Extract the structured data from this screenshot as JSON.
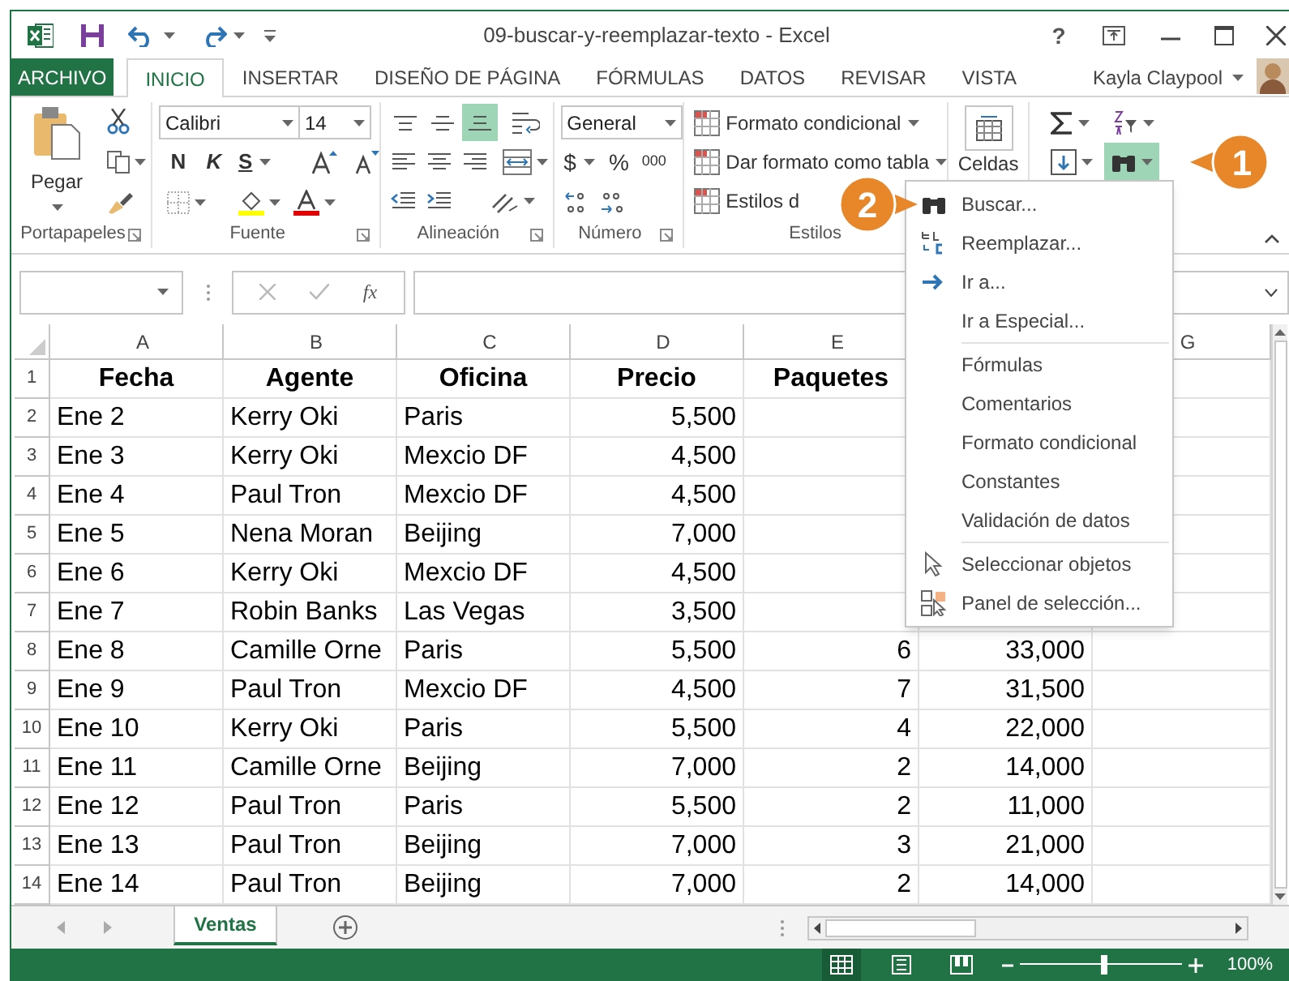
{
  "window": {
    "title": "09-buscar-y-reemplazar-texto - Excel",
    "help": "?"
  },
  "tabs": [
    {
      "label": "ARCHIVO",
      "kind": "file",
      "selected": false
    },
    {
      "label": "INICIO",
      "kind": "tab",
      "selected": true
    },
    {
      "label": "INSERTAR",
      "kind": "tab",
      "selected": false
    },
    {
      "label": "DISEÑO DE PÁGINA",
      "kind": "tab",
      "selected": false
    },
    {
      "label": "FÓRMULAS",
      "kind": "tab",
      "selected": false
    },
    {
      "label": "DATOS",
      "kind": "tab",
      "selected": false
    },
    {
      "label": "REVISAR",
      "kind": "tab",
      "selected": false
    },
    {
      "label": "VISTA",
      "kind": "tab",
      "selected": false
    }
  ],
  "user": {
    "name": "Kayla Claypool"
  },
  "ribbon": {
    "clipboard": {
      "paste": "Pegar",
      "label": "Portapapeles"
    },
    "font": {
      "name": "Calibri",
      "size": "14",
      "bold": "N",
      "italic": "K",
      "underline": "S",
      "label": "Fuente"
    },
    "alignment": {
      "label": "Alineación",
      "vertical": [
        {
          "selected": false
        },
        {
          "selected": false
        },
        {
          "selected": true
        }
      ]
    },
    "number": {
      "format": "General",
      "currency": "$",
      "percent": "%",
      "thousands": "000",
      "label": "Número"
    },
    "styles": {
      "items": [
        "Formato condicional",
        "Dar formato como tabla",
        "Estilos d"
      ],
      "label": "Estilos"
    },
    "cells": {
      "label": "Celdas"
    },
    "editing": {
      "find_expanded": true
    }
  },
  "formula_bar": {
    "function_label": "fx"
  },
  "sheet": {
    "columns": [
      "A",
      "B",
      "C",
      "D",
      "E",
      null,
      "G"
    ],
    "rows": [
      {
        "number": "1",
        "header": true,
        "cells": [
          "Fecha",
          "Agente",
          "Oficina",
          "Precio",
          "Paquetes"
        ]
      },
      {
        "number": "2",
        "header": false,
        "cells": [
          "Ene 2",
          "Kerry Oki",
          "Paris",
          "5,500"
        ]
      },
      {
        "number": "3",
        "header": false,
        "cells": [
          "Ene 3",
          "Kerry Oki",
          "Mexcio DF",
          "4,500"
        ]
      },
      {
        "number": "4",
        "header": false,
        "cells": [
          "Ene 4",
          "Paul Tron",
          "Mexcio DF",
          "4,500"
        ]
      },
      {
        "number": "5",
        "header": false,
        "cells": [
          "Ene 5",
          "Nena Moran",
          "Beijing",
          "7,000"
        ]
      },
      {
        "number": "6",
        "header": false,
        "cells": [
          "Ene 6",
          "Kerry Oki",
          "Mexcio DF",
          "4,500"
        ]
      },
      {
        "number": "7",
        "header": false,
        "cells": [
          "Ene 7",
          "Robin Banks",
          "Las Vegas",
          "3,500"
        ]
      },
      {
        "number": "8",
        "header": false,
        "cells": [
          "Ene 8",
          "Camille Orne",
          "Paris",
          "5,500",
          "6",
          "33,000"
        ]
      },
      {
        "number": "9",
        "header": false,
        "cells": [
          "Ene 9",
          "Paul Tron",
          "Mexcio DF",
          "4,500",
          "7",
          "31,500"
        ]
      },
      {
        "number": "10",
        "header": false,
        "cells": [
          "Ene 10",
          "Kerry Oki",
          "Paris",
          "5,500",
          "4",
          "22,000"
        ]
      },
      {
        "number": "11",
        "header": false,
        "cells": [
          "Ene 11",
          "Camille Orne",
          "Beijing",
          "7,000",
          "2",
          "14,000"
        ]
      },
      {
        "number": "12",
        "header": false,
        "cells": [
          "Ene 12",
          "Paul Tron",
          "Paris",
          "5,500",
          "2",
          "11,000"
        ]
      },
      {
        "number": "13",
        "header": false,
        "cells": [
          "Ene 13",
          "Paul Tron",
          "Beijing",
          "7,000",
          "3",
          "21,000"
        ]
      },
      {
        "number": "14",
        "header": false,
        "cells": [
          "Ene 14",
          "Paul Tron",
          "Beijing",
          "7,000",
          "2",
          "14,000"
        ]
      }
    ]
  },
  "menu": {
    "items": [
      {
        "label": "Buscar...",
        "kind": "find",
        "separator_after": false
      },
      {
        "label": "Reemplazar...",
        "kind": "replace",
        "separator_after": false
      },
      {
        "label": "Ir a...",
        "kind": "goto",
        "separator_after": false
      },
      {
        "label": "Ir a Especial...",
        "kind": "plain",
        "separator_after": true
      },
      {
        "label": "Fórmulas",
        "kind": "plain",
        "separator_after": false
      },
      {
        "label": "Comentarios",
        "kind": "plain",
        "separator_after": false
      },
      {
        "label": "Formato condicional",
        "kind": "plain",
        "separator_after": false
      },
      {
        "label": "Constantes",
        "kind": "plain",
        "separator_after": false
      },
      {
        "label": "Validación de datos",
        "kind": "plain",
        "separator_after": true
      },
      {
        "label": "Seleccionar objetos",
        "kind": "select",
        "separator_after": false
      },
      {
        "label": "Panel de selección...",
        "kind": "pane",
        "separator_after": false
      }
    ]
  },
  "callouts": [
    {
      "label": "1"
    },
    {
      "label": "2"
    }
  ],
  "sheet_tabs": [
    {
      "label": "Ventas",
      "selected": true
    }
  ],
  "status_bar": {
    "views": [
      {
        "selected": true
      },
      {
        "selected": false
      },
      {
        "selected": false
      }
    ],
    "zoom": {
      "level": 0.52,
      "reading": "100%"
    }
  }
}
